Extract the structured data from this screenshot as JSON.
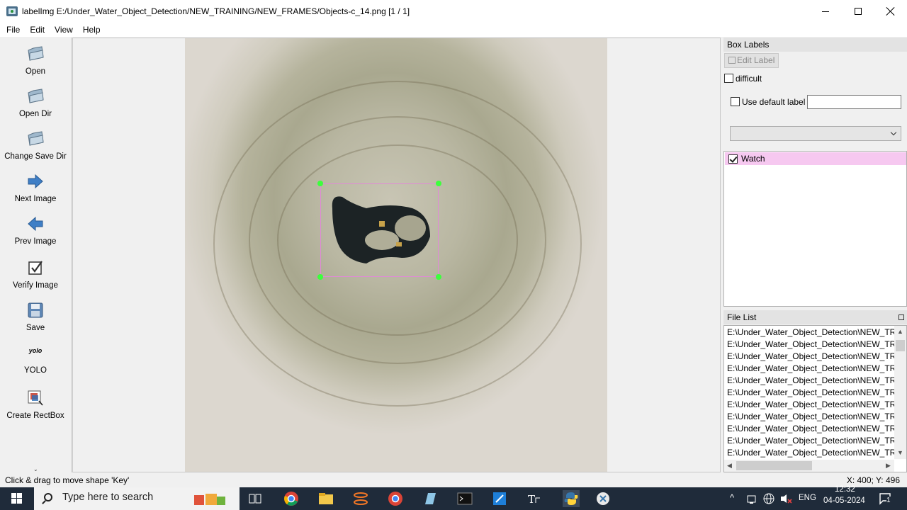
{
  "window": {
    "title": "labelImg E:/Under_Water_Object_Detection/NEW_TRAINING/NEW_FRAMES/Objects-c_14.png [1 / 1]"
  },
  "menu": [
    "File",
    "Edit",
    "View",
    "Help"
  ],
  "toolbar": {
    "open": "Open",
    "open_dir": "Open Dir",
    "change_save_dir": "Change Save Dir",
    "next_image": "Next Image",
    "prev_image": "Prev Image",
    "verify_image": "Verify Image",
    "save": "Save",
    "yolo_icon_text": "yolo",
    "yolo": "YOLO",
    "create_rectbox": "Create RectBox"
  },
  "box_labels": {
    "header": "Box Labels",
    "edit_label_button": "Edit Label",
    "difficult_label": "difficult",
    "difficult_checked": false,
    "use_default_label": "Use default label",
    "use_default_checked": false,
    "default_label_value": "",
    "combo_value": "",
    "labels": [
      {
        "name": "Watch",
        "checked": true,
        "color": "#f6c8f0"
      }
    ]
  },
  "file_list": {
    "header": "File List",
    "items": [
      "E:\\Under_Water_Object_Detection\\NEW_TRA",
      "E:\\Under_Water_Object_Detection\\NEW_TRA",
      "E:\\Under_Water_Object_Detection\\NEW_TRA",
      "E:\\Under_Water_Object_Detection\\NEW_TRA",
      "E:\\Under_Water_Object_Detection\\NEW_TRA",
      "E:\\Under_Water_Object_Detection\\NEW_TRA",
      "E:\\Under_Water_Object_Detection\\NEW_TRA",
      "E:\\Under_Water_Object_Detection\\NEW_TRA",
      "E:\\Under_Water_Object_Detection\\NEW_TRA",
      "E:\\Under_Water_Object_Detection\\NEW_TRA",
      "E:\\Under_Water_Object_Detection\\NEW_TRA"
    ]
  },
  "status": {
    "message": "Click & drag to move shape 'Key'",
    "coords": "X: 400; Y: 496"
  },
  "taskbar": {
    "search_placeholder": "Type here to search",
    "language": "ENG",
    "time": "12:32",
    "date": "04-05-2024",
    "notification_count": "1"
  },
  "colors": {
    "bbox": "#e08ad6",
    "handle": "#3cff3c",
    "label_row": "#f6c8f0",
    "taskbar": "#1f2b3a"
  }
}
